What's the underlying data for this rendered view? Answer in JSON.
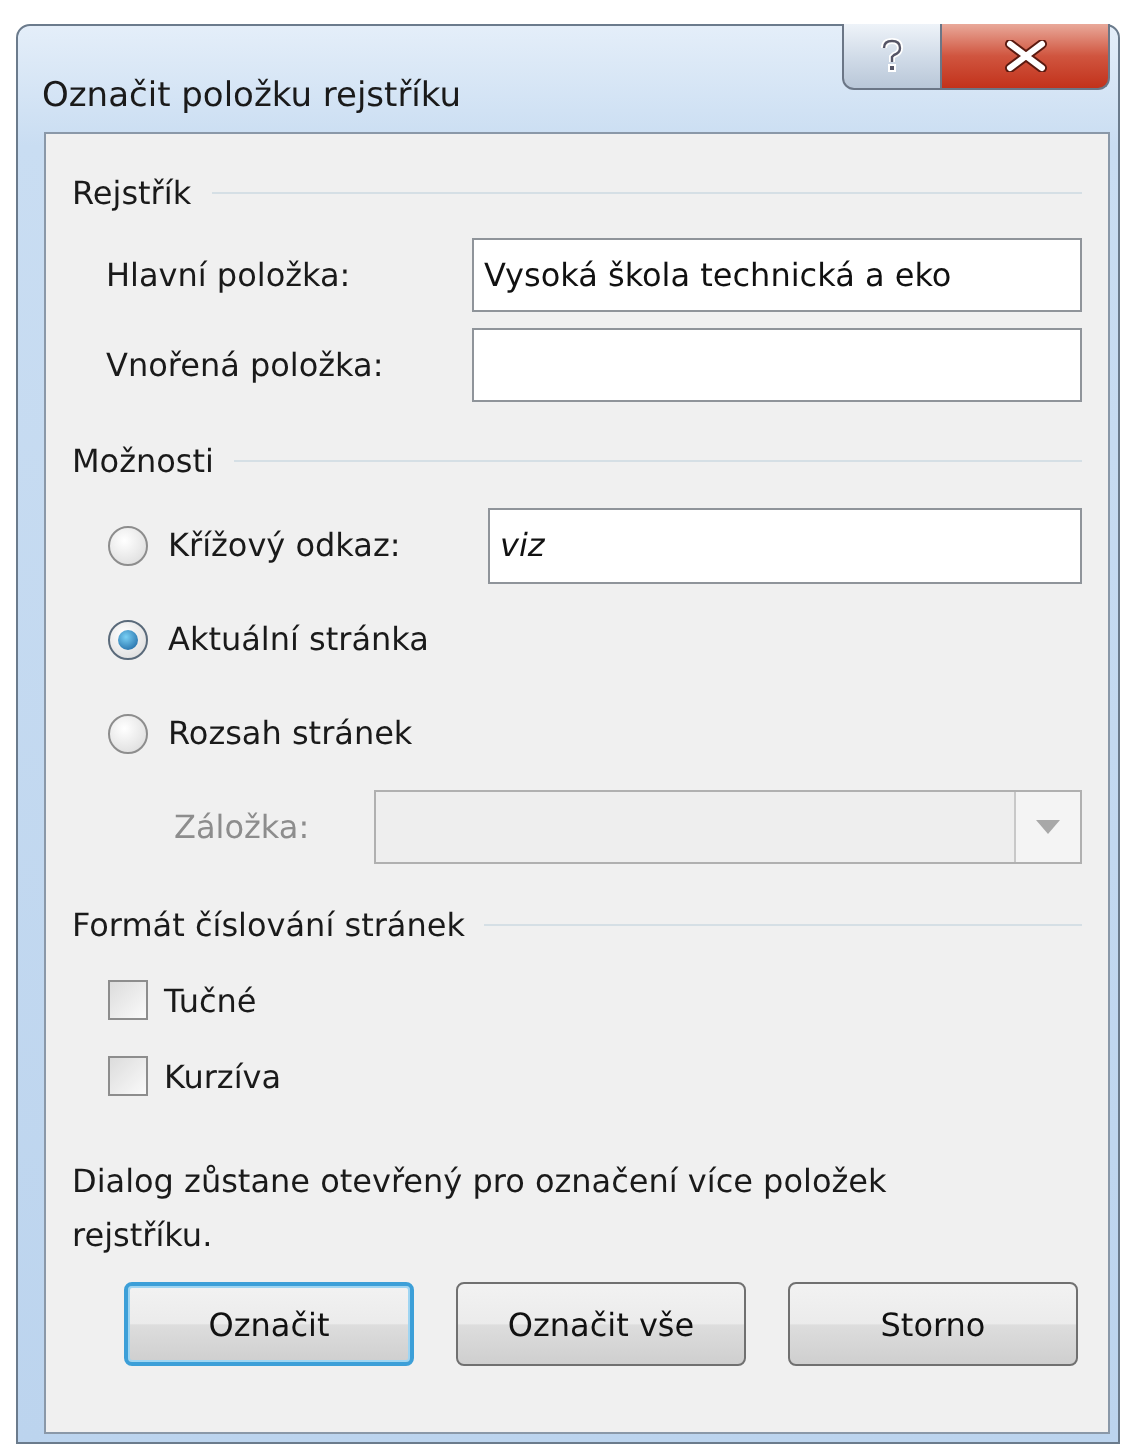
{
  "window": {
    "title": "Označit položku rejstříku"
  },
  "index": {
    "heading": "Rejstřík",
    "fields": [
      {
        "label": "Hlavní položka:",
        "value": "Vysoká škola technická a eko"
      },
      {
        "label": "Vnořená položka:"
      }
    ]
  },
  "options": {
    "heading": "Možnosti",
    "choices": [
      {
        "kind": "field",
        "label": "Křížový odkaz:",
        "selected": false,
        "value": "viz"
      },
      {
        "kind": "plain",
        "label": "Aktuální stránka",
        "selected": true
      },
      {
        "kind": "plain",
        "label": "Rozsah stránek",
        "selected": false
      }
    ],
    "bookmark": {
      "label": "Záložka:",
      "disabled": true
    }
  },
  "format": {
    "heading": "Formát číslování stránek",
    "checkboxes": [
      {
        "label": "Tučné",
        "checked": false
      },
      {
        "label": "Kurzíva",
        "checked": false
      }
    ]
  },
  "note": "Dialog zůstane otevřený pro označení více položek rejstříku.",
  "buttons": [
    {
      "label": "Označit",
      "default": true
    },
    {
      "label": "Označit vše",
      "default": false
    },
    {
      "label": "Storno",
      "default": false
    }
  ]
}
